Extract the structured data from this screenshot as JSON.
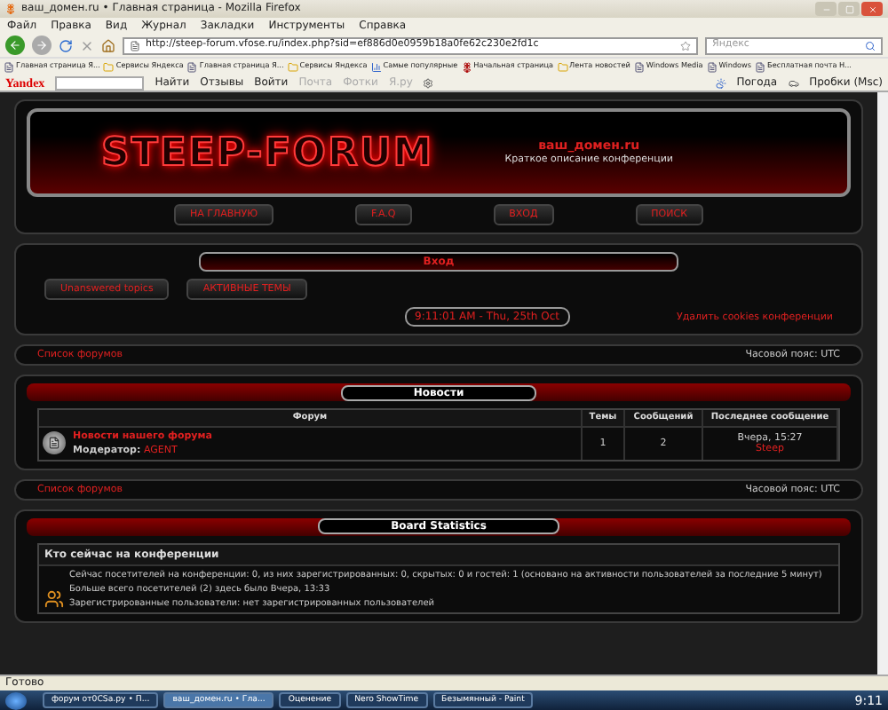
{
  "window": {
    "title": "ваш_домен.ru • Главная страница - Mozilla Firefox"
  },
  "menu": [
    "Файл",
    "Правка",
    "Вид",
    "Журнал",
    "Закладки",
    "Инструменты",
    "Справка"
  ],
  "address": {
    "url": "http://steep-forum.vfose.ru/index.php?sid=ef886d0e0959b18a0fe62c230e2fd1c"
  },
  "search": {
    "placeholder": "Яндекс"
  },
  "bookmarks": [
    {
      "label": "Главная страница Я...",
      "kind": "page"
    },
    {
      "label": "Сервисы Яндекса",
      "kind": "folder"
    },
    {
      "label": "Главная страница Я...",
      "kind": "page"
    },
    {
      "label": "Сервисы Яндекса",
      "kind": "folder"
    },
    {
      "label": "Самые популярные",
      "kind": "chart"
    },
    {
      "label": "Начальная страница",
      "kind": "flower"
    },
    {
      "label": "Лента новостей",
      "kind": "folder"
    },
    {
      "label": "Windows Media",
      "kind": "page"
    },
    {
      "label": "Windows",
      "kind": "page"
    },
    {
      "label": "Бесплатная почта H...",
      "kind": "page"
    }
  ],
  "yandex_bar": {
    "logo": "Yandex",
    "items": [
      {
        "label": "Найти",
        "disabled": false
      },
      {
        "label": "Отзывы",
        "disabled": false
      },
      {
        "label": "Войти",
        "disabled": false
      },
      {
        "label": "Почта",
        "disabled": true
      },
      {
        "label": "Фотки",
        "disabled": true
      },
      {
        "label": "Я.ру",
        "disabled": true
      }
    ],
    "right": [
      "Погода",
      "Пробки (Msc)"
    ]
  },
  "forum": {
    "logo": "STEEP-FORUM",
    "domain": "ваш_домен.ru",
    "description": "Краткое описание конференции",
    "nav": [
      "НА ГЛАВНУЮ",
      "F.A.Q",
      "ВХОД",
      "ПОИСК"
    ],
    "login_title": "Вход",
    "login_buttons": [
      "Unanswered topics",
      "АКТИВНЫЕ ТЕМЫ"
    ],
    "time": "9:11:01 AM - Thu, 25th Oct",
    "delete_cookies": "Удалить cookies конференции",
    "breadcrumb": "Список форумов",
    "timezone": "Часовой пояс: UTC",
    "news": {
      "title": "Новости",
      "columns": [
        "Форум",
        "Темы",
        "Сообщений",
        "Последнее сообщение"
      ],
      "rows": [
        {
          "name": "Новости нашего форума",
          "moderator_label": "Модератор:",
          "moderator": "AGENT",
          "topics": "1",
          "posts": "2",
          "last_time": "Вчера, 15:27",
          "last_author": "Steep"
        }
      ]
    },
    "breadcrumb_bottom": "Список форумов",
    "timezone_bottom": "Часовой пояс: UTC",
    "stats": {
      "title": "Board Statistics",
      "heading": "Кто сейчас на конференции",
      "lines": [
        "Сейчас посетителей на конференции: 0, из них зарегистрированных: 0, скрытых: 0 и гостей: 1 (основано на активности пользователей за последние 5 минут)",
        "Больше всего посетителей (2) здесь было Вчера, 13:33",
        "Зарегистрированные пользователи: нет зарегистрированных пользователей"
      ]
    }
  },
  "status_bar": "Готово",
  "taskbar": {
    "items": [
      {
        "label": "форум от0CSa.ру • П...",
        "selected": false
      },
      {
        "label": "ваш_домен.ru • Гла...",
        "selected": true
      },
      {
        "label": "Оценение",
        "selected": false
      },
      {
        "label": "Nero ShowTime",
        "selected": false
      },
      {
        "label": "Безымянный - Paint",
        "selected": false
      }
    ],
    "clock": "9:11"
  }
}
